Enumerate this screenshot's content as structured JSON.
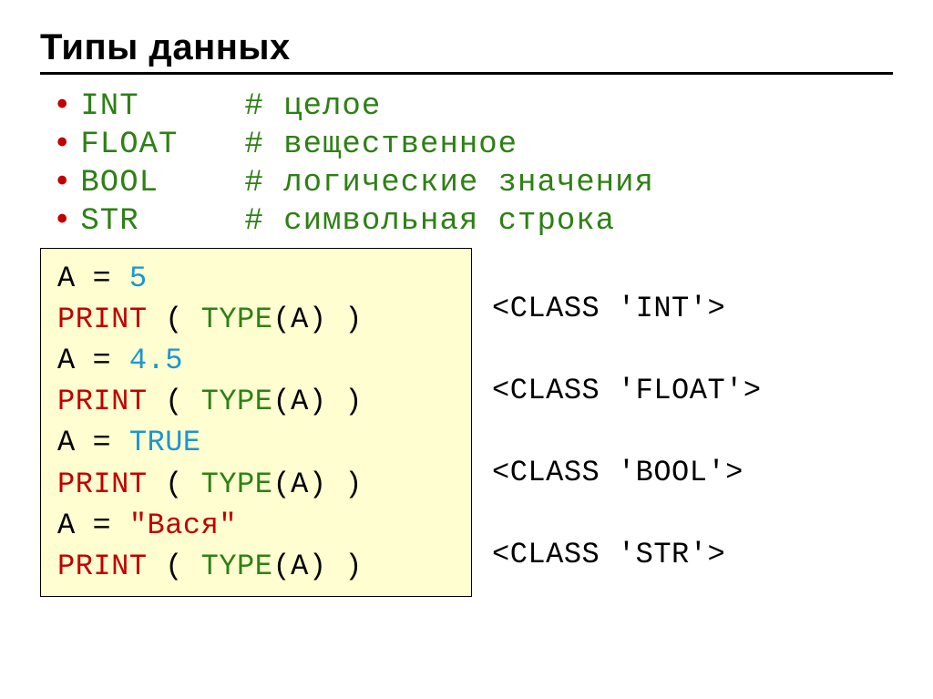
{
  "title": "Типы данных",
  "types": [
    {
      "key": "INT",
      "comment": "# целое"
    },
    {
      "key": "FLOAT",
      "comment": "# вещественное"
    },
    {
      "key": "BOOL",
      "comment": "# логические значения"
    },
    {
      "key": "STR",
      "comment": "# символьная строка"
    }
  ],
  "code": {
    "a1var": "A",
    "a1eq": "=",
    "a1val": "5",
    "p": "PRINT",
    "popen": " ( ",
    "t": "TYPE",
    "targ": "(A)",
    "pclose": " )",
    "a2var": "A",
    "a2eq": "=",
    "a2val": "4.5",
    "a3var": "A",
    "a3eq": "=",
    "a3val": "TRUE",
    "a4var": "A",
    "a4eq": "=",
    "a4val": "\"Вася\""
  },
  "outputs": {
    "o1": "<CLASS 'INT'>",
    "o2": "<CLASS 'FLOAT'>",
    "o3": "<CLASS 'BOOL'>",
    "o4": "<CLASS 'STR'>"
  }
}
